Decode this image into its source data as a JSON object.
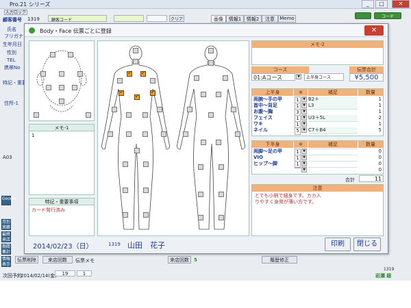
{
  "app": {
    "title": "Pro.21 シリーズ",
    "pill": "入力ロック",
    "window_buttons": [
      "_",
      "□",
      "✕"
    ]
  },
  "background": {
    "left_labels": [
      "顧客番号",
      "氏名",
      "フリガナ",
      "生年月日",
      "性別",
      "TEL",
      "携帯No",
      "特記・重要",
      "住所-1"
    ],
    "customer_no": "1319",
    "customer_code_label": "顧客コード",
    "clear_label": "クリア",
    "tabs": [
      "画像",
      "情報1",
      "情報2",
      "注意",
      "Memo"
    ],
    "code_label": "コード",
    "a03": "A03",
    "side_buttons": [
      "Google",
      "月別 実績",
      "最終 来店",
      "期間 集計",
      "情報 表示"
    ],
    "bottom_buttons": [
      "伝票削除",
      "来店回数",
      "伝票メモ",
      "来店回数",
      "履歴修正",
      "次回予約"
    ],
    "visit_count": "5",
    "next_reservation": "2014/02/14(金)",
    "next_nums": [
      "19",
      "1"
    ],
    "right_value": "岩瀬 総",
    "right_num": "1319"
  },
  "dialog": {
    "title": "Body・Face 伝票ごとに登録",
    "close": "✕",
    "memo1_label": "メモ-1",
    "memo1_value": "1",
    "notes_label": "特記・重要事項",
    "notes_value": "カード発行済み",
    "memo2_label": "メモ-2",
    "course_label": "コース",
    "course_value": "01:Aコース",
    "upper_course_label": "上半身コース",
    "total_label": "伝票合計",
    "total_value": "¥5,500",
    "upper_header": "上半身",
    "lower_header": "下半身",
    "x_header": "※",
    "supplement_header": "補足",
    "qty_header": "数量",
    "upper_rows": [
      {
        "label": "両腕～手の甲",
        "n": "1",
        "comment": "B2＋",
        "qty": "1"
      },
      {
        "label": "首中～背足",
        "n": "1",
        "comment": "L3",
        "qty": "1"
      },
      {
        "label": "お腹～胸",
        "n": "3",
        "comment": "",
        "qty": "1"
      },
      {
        "label": "フェイス",
        "n": "1",
        "comment": "U3＋5L",
        "qty": "2"
      },
      {
        "label": "ワキ",
        "n": "1",
        "comment": "",
        "qty": "1"
      },
      {
        "label": "ネイル",
        "n": "5",
        "comment": "C7＋B4",
        "qty": "5"
      }
    ],
    "lower_rows": [
      {
        "label": "両脚～足の甲",
        "n": "1",
        "comment": "",
        "qty": "0"
      },
      {
        "label": "VIO",
        "n": "1",
        "comment": "",
        "qty": "0"
      },
      {
        "label": "ヒップ～脚",
        "n": "1",
        "comment": "",
        "qty": "0"
      },
      {
        "label": "",
        "n": "",
        "comment": "",
        "qty": "0"
      }
    ],
    "sum_label": "合計",
    "sum_value": "11",
    "caution_label": "注意",
    "caution_text": "とても小柄で細身です。カカ入りやすく身発が薄い方です。",
    "date": "2014/02/23（日）",
    "customer_no": "1319",
    "customer_name": "山田　花子",
    "print_button": "印刷",
    "close_button": "閉じる"
  }
}
